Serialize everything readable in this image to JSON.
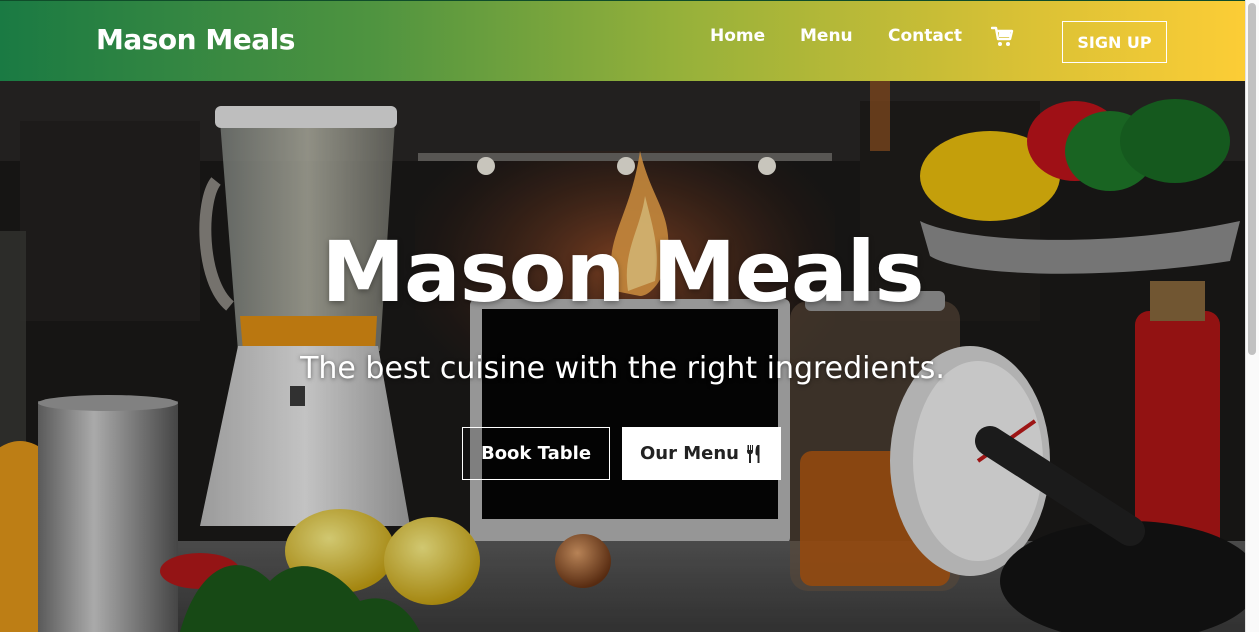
{
  "navbar": {
    "brand": "Mason Meals",
    "links": [
      "Home",
      "Menu",
      "Contact"
    ],
    "cart_icon": "shopping-cart-icon",
    "signup_label": "SIGN UP",
    "gradient_colors": [
      "#1a7a43",
      "#4f9440",
      "#97b13a",
      "#d9c135",
      "#fccd36"
    ]
  },
  "hero": {
    "title": "Mason Meals",
    "subtitle": "The best cuisine with the right ingredients.",
    "book_label": "Book Table",
    "menu_label": "Our Menu",
    "menu_icon": "utensils-icon",
    "background": "kitchen-scene-image"
  }
}
